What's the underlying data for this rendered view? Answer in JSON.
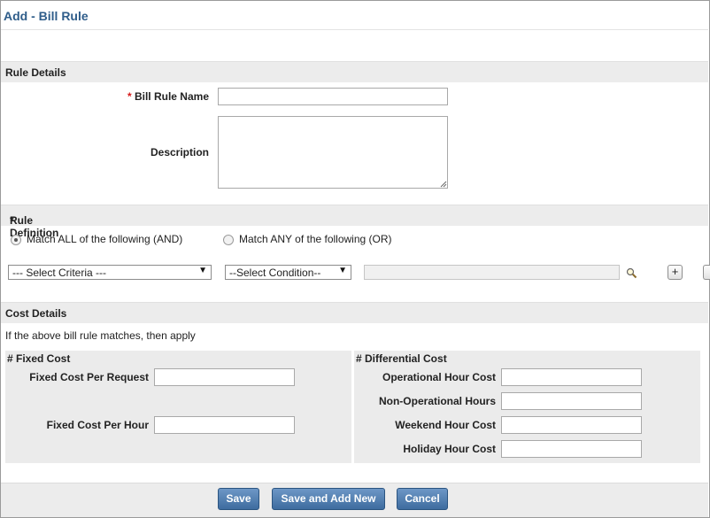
{
  "page": {
    "title": "Add - Bill Rule"
  },
  "rule_details": {
    "header": "Rule Details",
    "name_label": "Bill Rule Name",
    "name_required_mark": "*",
    "name_value": "",
    "description_label": "Description",
    "description_value": ""
  },
  "rule_definition": {
    "header": "Rule Definition",
    "required_mark": "*",
    "match_all_label": "Match ALL of the following (AND)",
    "match_any_label": "Match ANY of the following (OR)",
    "selected_match": "all",
    "criteria_select": "--- Select Criteria ---",
    "condition_select": "--Select Condition--",
    "criteria_value": "",
    "add_label": "+"
  },
  "cost_details": {
    "header": "Cost Details",
    "note": "If the above bill rule matches, then apply",
    "fixed": {
      "title": "# Fixed Cost",
      "per_request_label": "Fixed Cost Per Request",
      "per_request_value": "",
      "per_hour_label": "Fixed Cost Per Hour",
      "per_hour_value": ""
    },
    "differential": {
      "title": "# Differential Cost",
      "operational_label": "Operational Hour Cost",
      "operational_value": "",
      "non_operational_label": "Non-Operational Hours",
      "non_operational_value": "",
      "weekend_label": "Weekend Hour Cost",
      "weekend_value": "",
      "holiday_label": "Holiday Hour Cost",
      "holiday_value": ""
    }
  },
  "footer": {
    "save_label": "Save",
    "save_add_label": "Save and Add New",
    "cancel_label": "Cancel"
  }
}
